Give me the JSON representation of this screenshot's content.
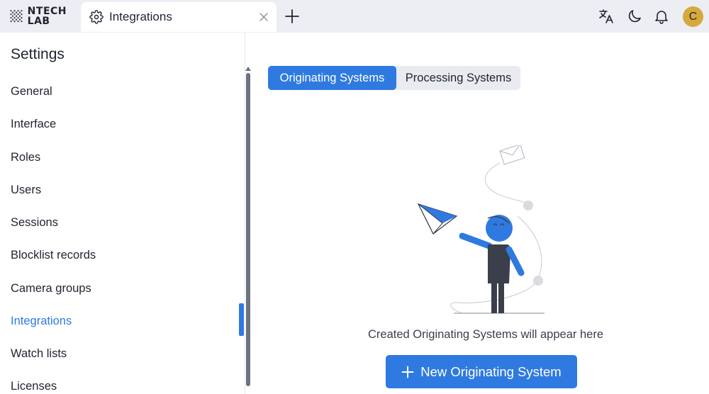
{
  "brand": {
    "line1": "NTECH",
    "line2": "LAB"
  },
  "tab": {
    "label": "Integrations",
    "icon": "gear-icon"
  },
  "header_icons": [
    "translate-icon",
    "moon-icon",
    "bell-icon"
  ],
  "user": {
    "initial": "C",
    "avatar_color": "#d6a93d"
  },
  "sidebar": {
    "title": "Settings",
    "items": [
      {
        "label": "General"
      },
      {
        "label": "Interface"
      },
      {
        "label": "Roles"
      },
      {
        "label": "Users"
      },
      {
        "label": "Sessions"
      },
      {
        "label": "Blocklist records"
      },
      {
        "label": "Camera groups"
      },
      {
        "label": "Integrations",
        "active": true
      },
      {
        "label": "Watch lists"
      },
      {
        "label": "Licenses"
      }
    ]
  },
  "segments": {
    "selected": "Originating Systems",
    "other": "Processing Systems"
  },
  "empty_state": {
    "message": "Created Originating Systems will appear here"
  },
  "primary_action": {
    "label": "New Originating System"
  },
  "colors": {
    "accent": "#2f7ae0",
    "topbar": "#eceef3",
    "segment_bg": "#e9ebf0"
  }
}
